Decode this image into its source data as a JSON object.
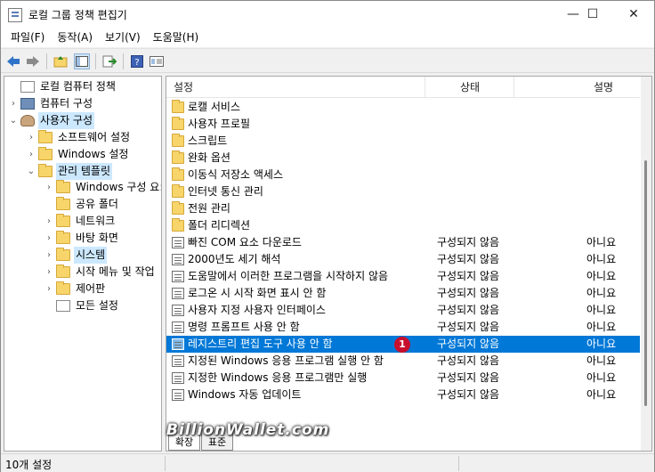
{
  "window": {
    "title": "로컬 그룹 정책 편집기",
    "minimize": "—",
    "maximize": "☐",
    "close": "✕"
  },
  "menu": [
    "파일(F)",
    "동작(A)",
    "보기(V)",
    "도움말(H)"
  ],
  "tree": [
    {
      "label": "로컬 컴퓨터 정책",
      "icon": "document-icon",
      "exp": ""
    },
    {
      "label": "컴퓨터 구성",
      "icon": "computer-icon",
      "exp": "›"
    },
    {
      "label": "사용자 구성",
      "icon": "user-icon",
      "exp": "⌄"
    },
    {
      "label": "소프트웨어 설정",
      "icon": "folder-icon",
      "exp": "›"
    },
    {
      "label": "Windows 설정",
      "icon": "folder-icon",
      "exp": "›"
    },
    {
      "label": "관리 템플릿",
      "icon": "folder-icon",
      "exp": "⌄"
    },
    {
      "label": "Windows 구성 요:",
      "icon": "folder-icon",
      "exp": "›"
    },
    {
      "label": "공유 폴더",
      "icon": "folder-icon",
      "exp": ""
    },
    {
      "label": "네트워크",
      "icon": "folder-icon",
      "exp": "›"
    },
    {
      "label": "바탕 화면",
      "icon": "folder-icon",
      "exp": "›"
    },
    {
      "label": "시스템",
      "icon": "folder-icon",
      "exp": "›"
    },
    {
      "label": "시작 메뉴 및 작업",
      "icon": "folder-icon",
      "exp": "›"
    },
    {
      "label": "제어판",
      "icon": "folder-icon",
      "exp": "›"
    },
    {
      "label": "모든 설정",
      "icon": "all-settings-icon",
      "exp": ""
    }
  ],
  "list": {
    "columns": {
      "name": "설정",
      "state": "상태",
      "note": "설명"
    },
    "rows": [
      {
        "name": "로캘 서비스",
        "type": "folder",
        "state": "",
        "note": ""
      },
      {
        "name": "사용자 프로필",
        "type": "folder",
        "state": "",
        "note": ""
      },
      {
        "name": "스크립트",
        "type": "folder",
        "state": "",
        "note": ""
      },
      {
        "name": "완화 옵션",
        "type": "folder",
        "state": "",
        "note": ""
      },
      {
        "name": "이동식 저장소 액세스",
        "type": "folder",
        "state": "",
        "note": ""
      },
      {
        "name": "인터넷 통신 관리",
        "type": "folder",
        "state": "",
        "note": ""
      },
      {
        "name": "전원 관리",
        "type": "folder",
        "state": "",
        "note": ""
      },
      {
        "name": "폴더 리디렉션",
        "type": "folder",
        "state": "",
        "note": ""
      },
      {
        "name": "빠진 COM 요소 다운로드",
        "type": "setting",
        "state": "구성되지 않음",
        "note": "아니요"
      },
      {
        "name": "2000년도 세기 해석",
        "type": "setting",
        "state": "구성되지 않음",
        "note": "아니요"
      },
      {
        "name": "도움말에서 이러한 프로그램을 시작하지 않음",
        "type": "setting",
        "state": "구성되지 않음",
        "note": "아니요"
      },
      {
        "name": "로그온 시 시작 화면 표시 안 함",
        "type": "setting",
        "state": "구성되지 않음",
        "note": "아니요"
      },
      {
        "name": "사용자 지정 사용자 인터페이스",
        "type": "setting",
        "state": "구성되지 않음",
        "note": "아니요"
      },
      {
        "name": "명령 프롬프트 사용 안 함",
        "type": "setting",
        "state": "구성되지 않음",
        "note": "아니요"
      },
      {
        "name": "레지스트리 편집 도구 사용 안 함",
        "type": "setting",
        "state": "구성되지 않음",
        "note": "아니요"
      },
      {
        "name": "지정된 Windows 응용 프로그램 실행 안 함",
        "type": "setting",
        "state": "구성되지 않음",
        "note": "아니요"
      },
      {
        "name": "지정한 Windows 응용 프로그램만 실행",
        "type": "setting",
        "state": "구성되지 않음",
        "note": "아니요"
      },
      {
        "name": "Windows 자동 업데이트",
        "type": "setting",
        "state": "구성되지 않음",
        "note": "아니요"
      }
    ],
    "selected_index": 14,
    "badge": "1"
  },
  "tabs": [
    "확장",
    "표준"
  ],
  "watermark": "BillionWallet.com",
  "status": "10개 설정",
  "colors": {
    "selection": "#0078d7",
    "tree_selection": "#cce8ff",
    "badge": "#c8102e",
    "folder": "#f7d56b"
  }
}
